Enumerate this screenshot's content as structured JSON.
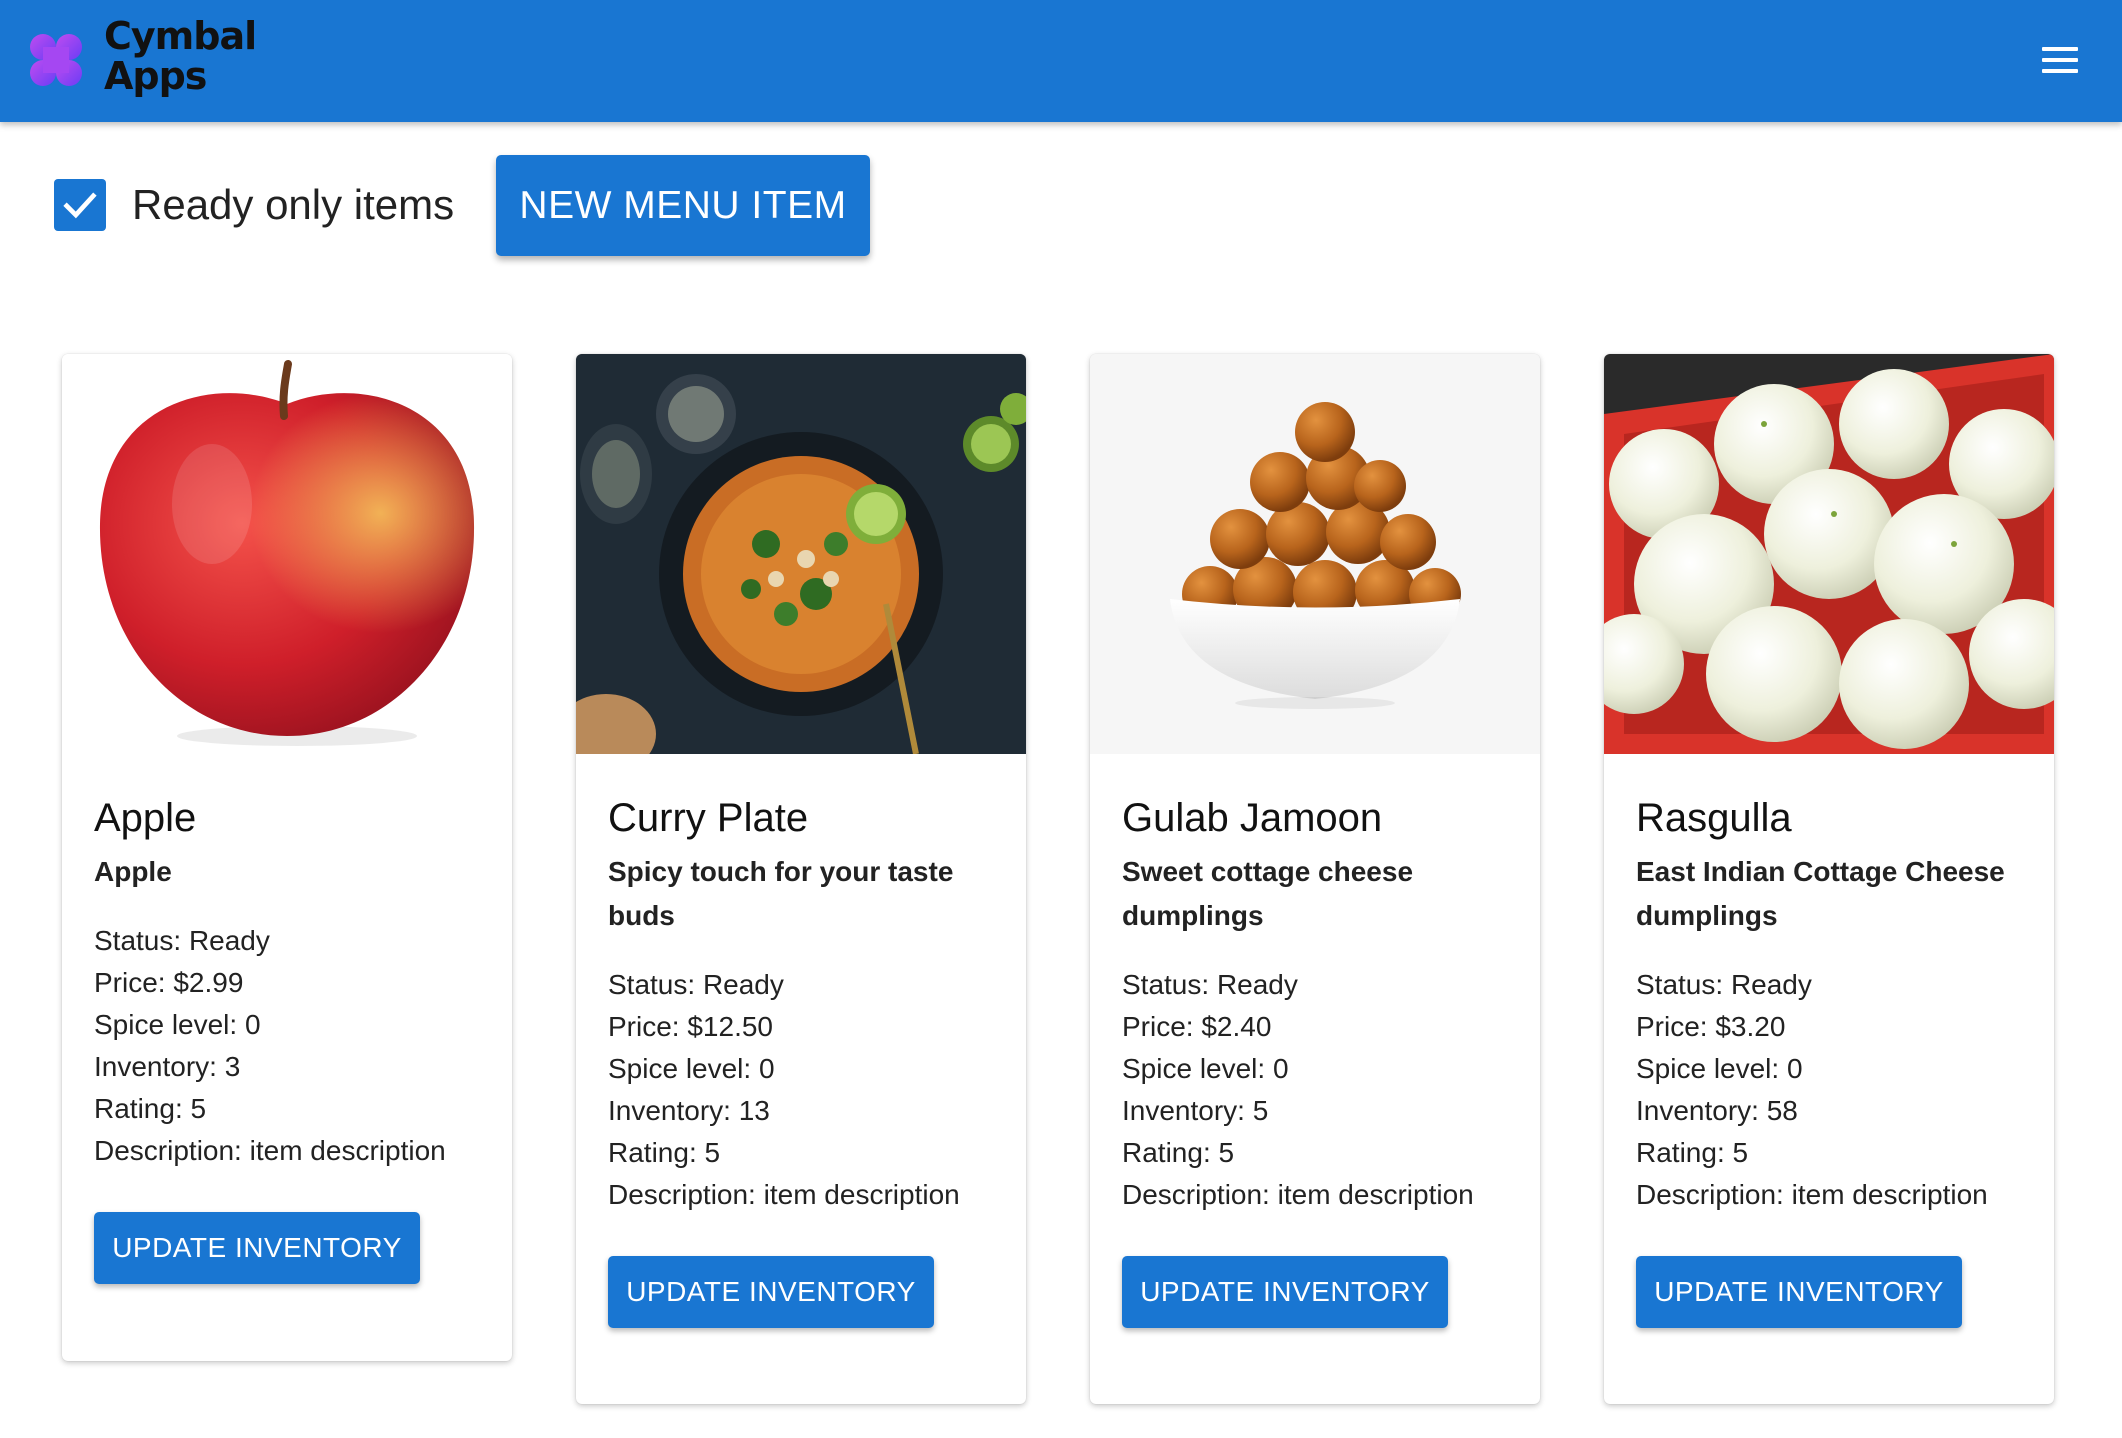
{
  "header": {
    "brand_line1": "Cymbal",
    "brand_line2": "Apps",
    "background": "#1976d2"
  },
  "toolbar": {
    "ready_only_label": "Ready only items",
    "ready_only_checked": true,
    "new_item_label": "NEW MENU ITEM"
  },
  "labels": {
    "status": "Status: ",
    "price": "Price: ",
    "spice": "Spice level: ",
    "inventory": "Inventory: ",
    "rating": "Rating: ",
    "description": "Description: "
  },
  "items": [
    {
      "name": "Apple",
      "tagline": "Apple",
      "status": "Ready",
      "price": "$2.99",
      "spice": "0",
      "inventory": "3",
      "rating": "5",
      "description": "item description",
      "button": "UPDATE INVENTORY",
      "image": "apple"
    },
    {
      "name": "Curry Plate",
      "tagline": "Spicy touch for your taste buds",
      "status": "Ready",
      "price": "$12.50",
      "spice": "0",
      "inventory": "13",
      "rating": "5",
      "description": "item description",
      "button": "UPDATE INVENTORY",
      "image": "curry-plate"
    },
    {
      "name": "Gulab Jamoon",
      "tagline": "Sweet cottage cheese dumplings",
      "status": "Ready",
      "price": "$2.40",
      "spice": "0",
      "inventory": "5",
      "rating": "5",
      "description": "item description",
      "button": "UPDATE INVENTORY",
      "image": "gulab-jamoon"
    },
    {
      "name": "Rasgulla",
      "tagline": "East Indian Cottage Cheese dumplings",
      "status": "Ready",
      "price": "$3.20",
      "spice": "0",
      "inventory": "58",
      "rating": "5",
      "description": "item description",
      "button": "UPDATE INVENTORY",
      "image": "rasgulla"
    }
  ]
}
